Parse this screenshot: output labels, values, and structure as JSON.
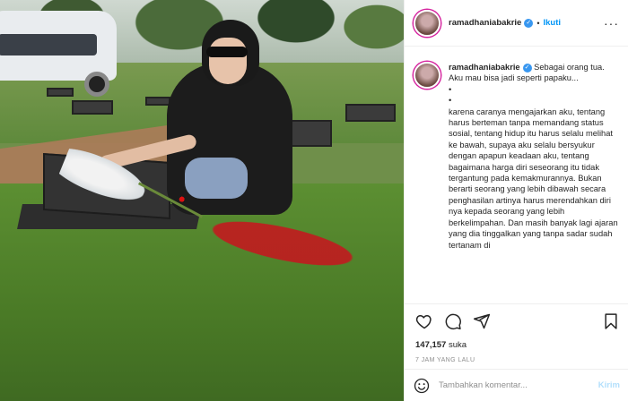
{
  "post": {
    "username": "ramadhaniabakrie",
    "verified_glyph": "✓",
    "separator": "•",
    "follow_label": "Ikuti",
    "more_glyph": "···",
    "caption_text": "Sebagai orang tua. Aku mau bisa jadi seperti papaku...\n•\n•\nkarena caranya mengajarkan aku, tentang harus berteman tanpa memandang status sosial, tentang hidup itu harus selalu melihat ke bawah, supaya aku selalu bersyukur dengan apapun keadaan aku, tentang bagaimana harga diri seseorang itu tidak tergantung pada kemakmurannya. Bukan berarti seorang yang lebih dibawah secara penghasilan artinya harus merendahkan diri nya kepada seorang yang lebih berkelimpahan. Dan masih banyak lagi ajaran yang dia tinggalkan yang tanpa sadar sudah tertanam di",
    "likes_count": "147,157",
    "likes_suffix": "suka",
    "timestamp": "7 JAM YANG LALU"
  },
  "actions": {
    "icons": [
      "heart-icon",
      "comment-icon",
      "share-icon",
      "bookmark-icon"
    ]
  },
  "comment_box": {
    "placeholder": "Tambahkan komentar...",
    "post_label": "Kirim"
  },
  "colors": {
    "follow": "#0095f6",
    "verified": "#3897f0",
    "post_disabled": "#b2dffc",
    "story_ring": "#d6249f"
  }
}
